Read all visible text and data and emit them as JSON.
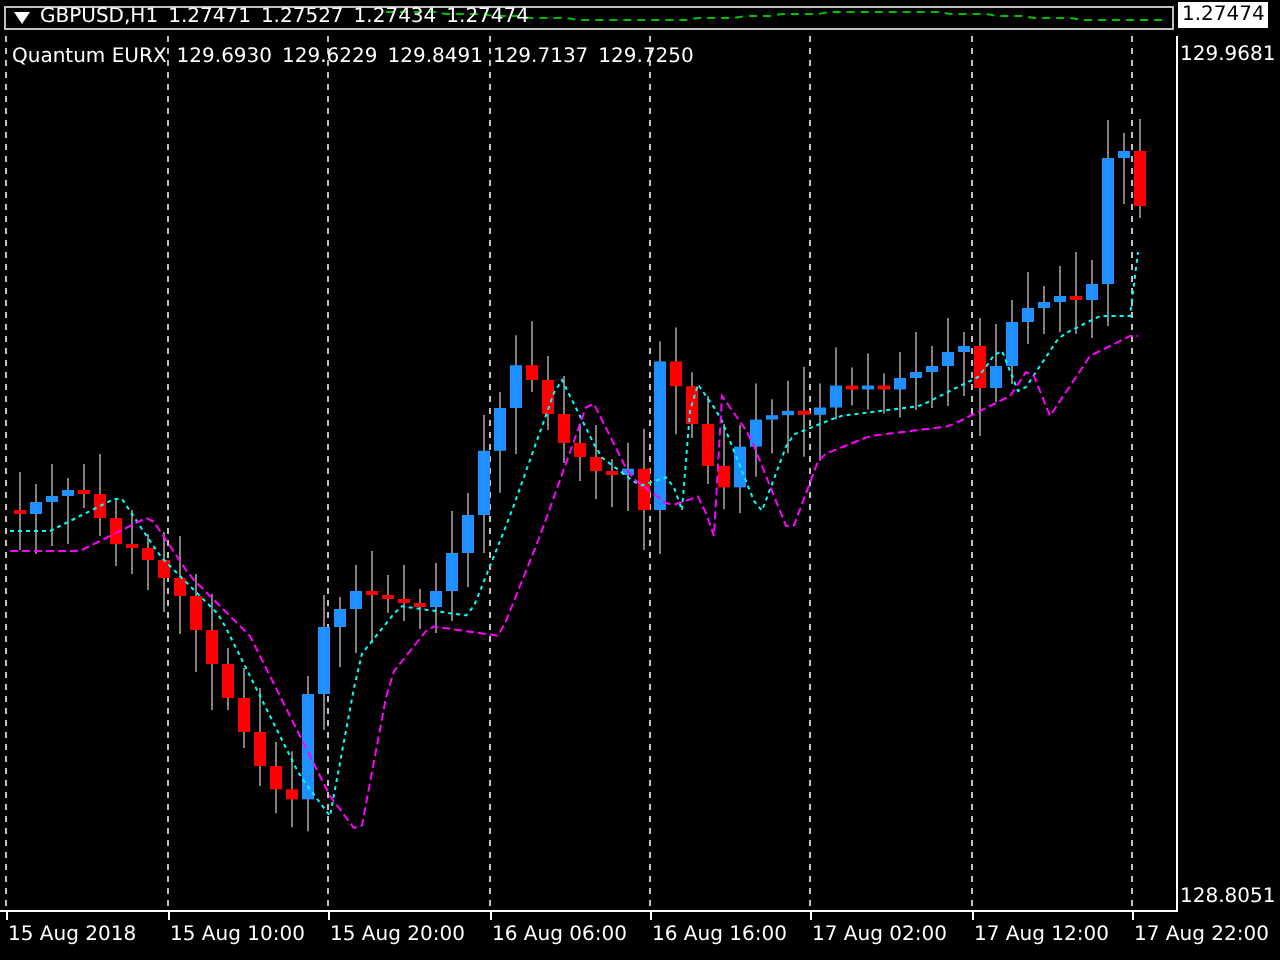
{
  "top_panel": {
    "title": "GBPUSD,H1",
    "values": [
      "1.27471",
      "1.27527",
      "1.27434",
      "1.27474"
    ],
    "price_label": "1.27474"
  },
  "main_chart": {
    "indicator_title": "Quantum EURX",
    "values": [
      "129.6930",
      "129.6229",
      "129.8491",
      "129.7137",
      "129.7250"
    ],
    "price_labels": [
      "129.9681",
      "128.8051"
    ]
  },
  "time_axis": {
    "labels": [
      "15 Aug 2018",
      "15 Aug 10:00",
      "15 Aug 20:00",
      "16 Aug 06:00",
      "16 Aug 16:00",
      "17 Aug 02:00",
      "17 Aug 12:00",
      "17 Aug 22:00"
    ]
  }
}
